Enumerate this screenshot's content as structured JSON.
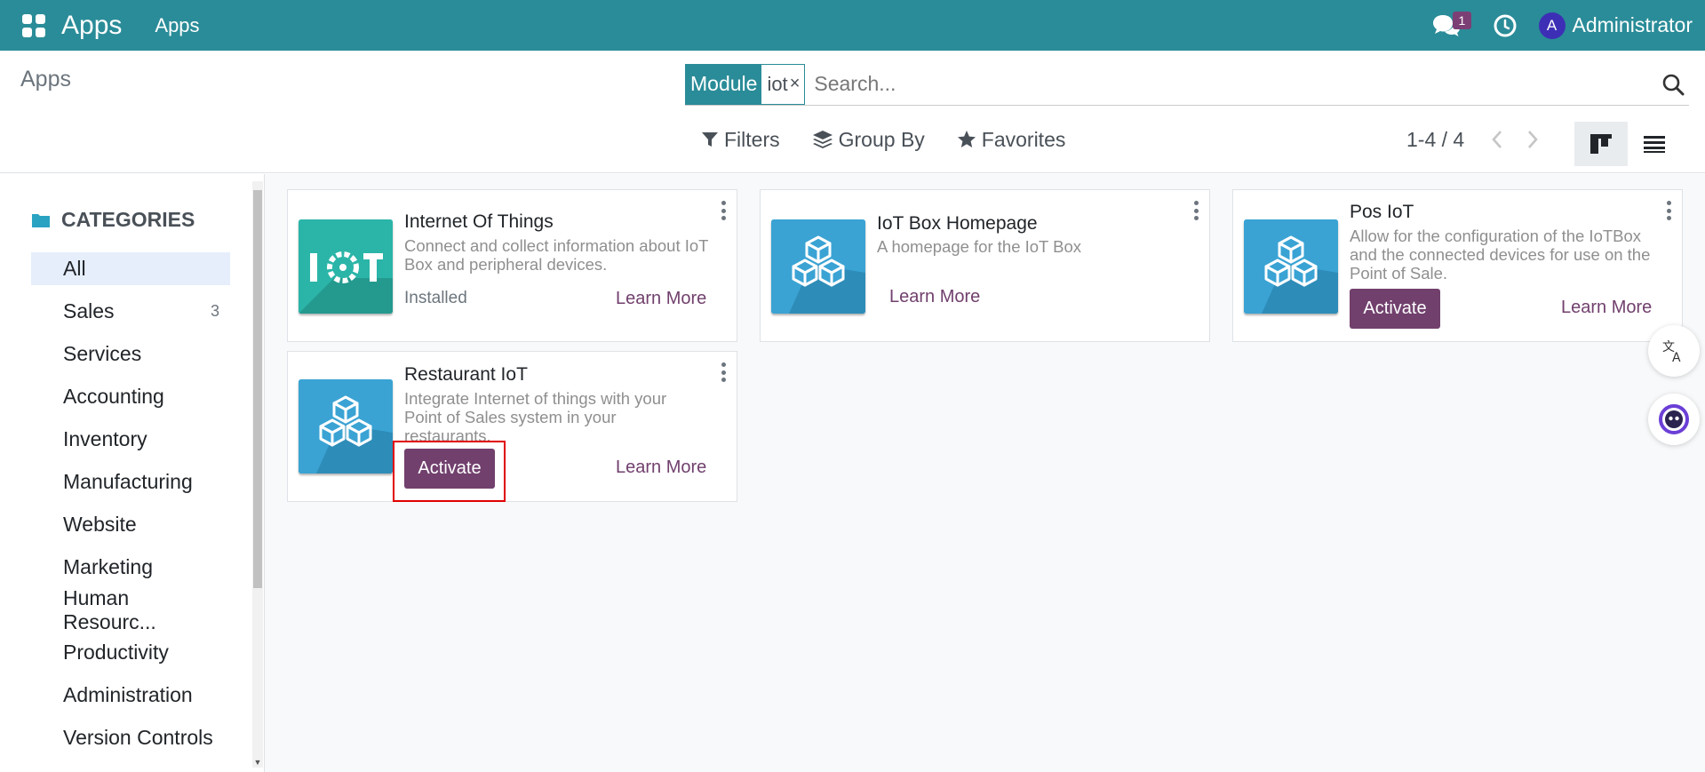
{
  "navbar": {
    "brand": "Apps",
    "menu_item": "Apps",
    "message_badge": "1",
    "user_initial": "A",
    "user_name": "Administrator",
    "background_color": "#2a8c98"
  },
  "control_panel": {
    "breadcrumb": "Apps",
    "search": {
      "facet_category": "Module",
      "facet_value": "iot",
      "placeholder": "Search..."
    },
    "filters_label": "Filters",
    "group_by_label": "Group By",
    "favorites_label": "Favorites",
    "pager_value": "1-4 / 4"
  },
  "sidebar": {
    "header": "CATEGORIES",
    "items": [
      {
        "label": "All",
        "count": ""
      },
      {
        "label": "Sales",
        "count": "3"
      },
      {
        "label": "Services",
        "count": ""
      },
      {
        "label": "Accounting",
        "count": ""
      },
      {
        "label": "Inventory",
        "count": ""
      },
      {
        "label": "Manufacturing",
        "count": ""
      },
      {
        "label": "Website",
        "count": ""
      },
      {
        "label": "Marketing",
        "count": ""
      },
      {
        "label": "Human Resourc...",
        "count": ""
      },
      {
        "label": "Productivity",
        "count": ""
      },
      {
        "label": "Administration",
        "count": ""
      },
      {
        "label": "Version Controls",
        "count": ""
      }
    ]
  },
  "cards": [
    {
      "title": "Internet Of Things",
      "description": "Connect and collect information about IoT Box and peripheral devices.",
      "status": "Installed",
      "learn_more": "Learn More",
      "icon": "iot-logo-icon",
      "icon_text": "I T"
    },
    {
      "title": "IoT Box Homepage",
      "description": "A homepage for the IoT Box",
      "learn_more": "Learn More",
      "icon": "cubes-icon"
    },
    {
      "title": "Pos IoT",
      "description": "Allow for the configuration of the IoTBox and the connected devices for use on the Point of Sale.",
      "activate": "Activate",
      "learn_more": "Learn More",
      "icon": "cubes-icon"
    },
    {
      "title": "Restaurant IoT",
      "description": "Integrate Internet of things with your Point of Sales system in your restaurants.",
      "activate": "Activate",
      "learn_more": "Learn More",
      "icon": "cubes-icon"
    }
  ],
  "colors": {
    "accent": "#71406d",
    "iot_icon_bg": "#2bb5a8",
    "cubes_icon_bg": "#3aa3d4",
    "highlight": "#e00000"
  }
}
